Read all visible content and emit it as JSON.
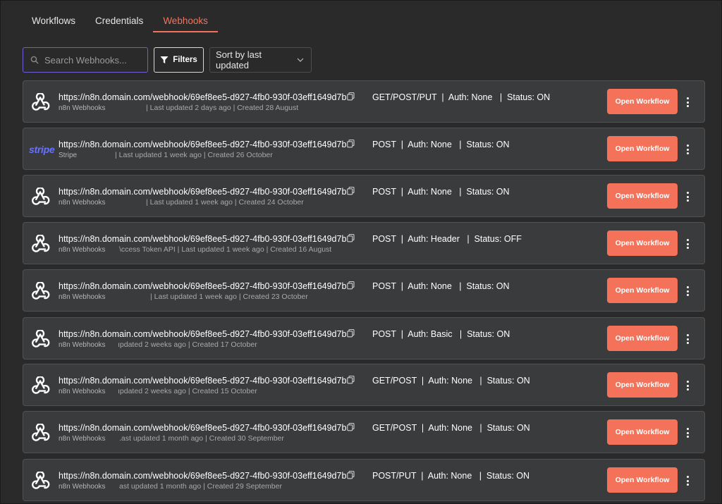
{
  "tabs": [
    {
      "label": "Workflows"
    },
    {
      "label": "Credentials"
    },
    {
      "label": "Webhooks",
      "active": true
    }
  ],
  "search": {
    "placeholder": "Search Webhooks..."
  },
  "filters_label": "Filters",
  "sort": {
    "label": "Sort by last updated"
  },
  "open_label": "Open Workflow",
  "colors": {
    "accent": "#f4725a",
    "search_border": "#6d5fd6",
    "stripe": "#6773ff"
  },
  "webhooks": [
    {
      "icon": "webhook-icon",
      "url": "https://n8n.domain.com/webhook/69ef8ee5-d927-4fb0-930f-03eff1649d7b",
      "meta": "GET/POST/PUT  |  Auth: None   |  Status: ON",
      "source": "n8n Webhooks",
      "updated": "| Last updated 2 days ago | Created 28 August"
    },
    {
      "icon": "stripe-logo",
      "logo_text": "stripe",
      "url": "https://n8n.domain.com/webhook/69ef8ee5-d927-4fb0-930f-03eff1649d7b",
      "meta": "POST  |  Auth: None   |  Status: ON",
      "source": "Stripe",
      "updated": "| Last updated 1 week ago | Created 26 October"
    },
    {
      "icon": "webhook-icon",
      "url": "https://n8n.domain.com/webhook/69ef8ee5-d927-4fb0-930f-03eff1649d7b",
      "meta": "POST  |  Auth: None   |  Status: ON",
      "source": "n8n Webhooks",
      "updated": "| Last updated 1 week ago | Created 24 October"
    },
    {
      "icon": "webhook-icon",
      "url": "https://n8n.domain.com/webhook/69ef8ee5-d927-4fb0-930f-03eff1649d7b",
      "meta": "POST  |  Auth: Header   |  Status: OFF",
      "source": "n8n Webhooks",
      "updated": "\\ccess Token API | Last updated 1 week ago | Created 16 August"
    },
    {
      "icon": "webhook-icon",
      "url": "https://n8n.domain.com/webhook/69ef8ee5-d927-4fb0-930f-03eff1649d7b",
      "meta": "POST  |  Auth: None   |  Status: ON",
      "source": "n8n Webhooks",
      "updated": "| Last updated 1 week ago | Created 23 October"
    },
    {
      "icon": "webhook-icon",
      "url": "https://n8n.domain.com/webhook/69ef8ee5-d927-4fb0-930f-03eff1649d7b",
      "meta": "POST  |  Auth: Basic   |  Status: ON",
      "source": "n8n Webhooks",
      "updated": "ıpdated 2 weeks ago | Created 17 October"
    },
    {
      "icon": "webhook-icon",
      "url": "https://n8n.domain.com/webhook/69ef8ee5-d927-4fb0-930f-03eff1649d7b",
      "meta": "GET/POST  |  Auth: None   |  Status: ON",
      "source": "n8n Webhooks",
      "updated": "ıpdated 2 weeks ago | Created 15 October"
    },
    {
      "icon": "webhook-icon",
      "url": "https://n8n.domain.com/webhook/69ef8ee5-d927-4fb0-930f-03eff1649d7b",
      "meta": "GET/POST  |  Auth: None   |  Status: ON",
      "source": "n8n Webhooks",
      "updated": ".ast updated 1 month ago | Created 30 September"
    },
    {
      "icon": "webhook-icon",
      "url": "https://n8n.domain.com/webhook/69ef8ee5-d927-4fb0-930f-03eff1649d7b",
      "meta": "POST/PUT  |  Auth: None   |  Status: ON",
      "source": "n8n Webhooks",
      "updated": "ast updated 1 month ago | Created 29 September"
    }
  ]
}
